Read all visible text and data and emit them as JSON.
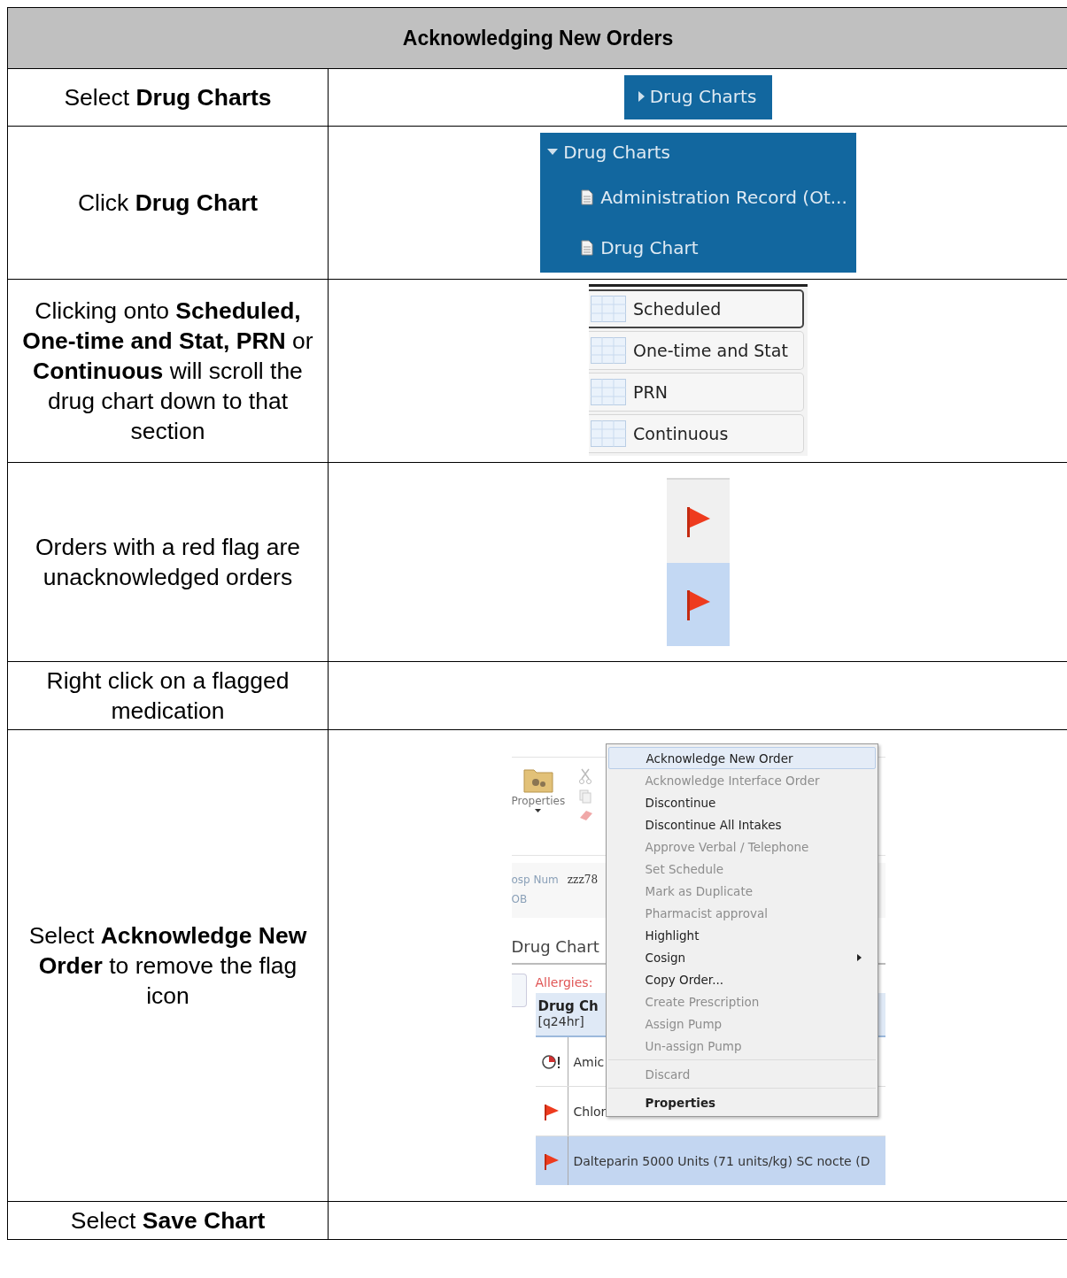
{
  "table": {
    "title": "Acknowledging New Orders",
    "rows": [
      {
        "instruction": "Select **Drug Charts**",
        "visual": {
          "kind": "nav",
          "expanded": false,
          "label": "Drug Charts"
        }
      },
      {
        "instruction": "Click **Drug Chart**",
        "visual": {
          "kind": "nav",
          "expanded": true,
          "label": "Drug Charts",
          "items": [
            "Administration Record (Ot...",
            "Drug Chart"
          ]
        }
      },
      {
        "instruction": "Clicking onto **Scheduled, One-time and Stat, PRN** or **Continuous** will scroll the drug chart down to that section",
        "visual": {
          "kind": "section-tabs",
          "tabs": [
            {
              "label": "Scheduled",
              "selected": true
            },
            {
              "label": "One-time and Stat",
              "selected": false
            },
            {
              "label": "PRN",
              "selected": false
            },
            {
              "label": "Continuous",
              "selected": false
            }
          ]
        }
      },
      {
        "instruction": "Orders with a red flag are unacknowledged orders",
        "visual": {
          "kind": "flags",
          "rows": [
            {
              "selected": false
            },
            {
              "selected": true
            }
          ]
        }
      },
      {
        "instruction": "Right click on a flagged medication"
      },
      {
        "instruction": "Select **Acknowledge New Order** to remove the flag icon",
        "visual": {
          "kind": "context-menu",
          "toolbar_button": "Properties",
          "hosp_label": "osp Num",
          "hosp_value": "zzz78",
          "dob_label": "OB",
          "heading": "Drug Chart",
          "allergies": "Allergies:",
          "section_title": "Drug Ch",
          "section_frequency": "[q24hr]",
          "orders": [
            {
              "name": "Amic",
              "kind": "clock",
              "selected": false
            },
            {
              "name": "Chlor",
              "kind": "flag",
              "selected": false
            },
            {
              "name": "Dalteparin 5000 Units (71 units/kg) SC nocte (D",
              "kind": "flag",
              "selected": true
            }
          ],
          "menu": [
            {
              "items": [
                {
                  "label": "Acknowledge New Order",
                  "disabled": false,
                  "selected": true,
                  "submenu": false,
                  "default": false
                },
                {
                  "label": "Acknowledge Interface Order",
                  "disabled": true,
                  "selected": false,
                  "submenu": false,
                  "default": false
                },
                {
                  "label": "Discontinue",
                  "disabled": false,
                  "selected": false,
                  "submenu": false,
                  "default": false
                },
                {
                  "label": "Discontinue All Intakes",
                  "disabled": false,
                  "selected": false,
                  "submenu": false,
                  "default": false
                },
                {
                  "label": "Approve Verbal / Telephone",
                  "disabled": true,
                  "selected": false,
                  "submenu": false,
                  "default": false
                },
                {
                  "label": "Set Schedule",
                  "disabled": true,
                  "selected": false,
                  "submenu": false,
                  "default": false
                },
                {
                  "label": "Mark as Duplicate",
                  "disabled": true,
                  "selected": false,
                  "submenu": false,
                  "default": false
                },
                {
                  "label": "Pharmacist approval",
                  "disabled": true,
                  "selected": false,
                  "submenu": false,
                  "default": false
                },
                {
                  "label": "Highlight",
                  "disabled": false,
                  "selected": false,
                  "submenu": false,
                  "default": false
                },
                {
                  "label": "Cosign",
                  "disabled": false,
                  "selected": false,
                  "submenu": true,
                  "default": false
                },
                {
                  "label": "Copy Order...",
                  "disabled": false,
                  "selected": false,
                  "submenu": false,
                  "default": false
                },
                {
                  "label": "Create Prescription",
                  "disabled": true,
                  "selected": false,
                  "submenu": false,
                  "default": false
                },
                {
                  "label": "Assign Pump",
                  "disabled": true,
                  "selected": false,
                  "submenu": false,
                  "default": false
                },
                {
                  "label": "Un-assign Pump",
                  "disabled": true,
                  "selected": false,
                  "submenu": false,
                  "default": false
                }
              ]
            },
            {
              "items": [
                {
                  "label": "Discard",
                  "disabled": true,
                  "selected": false,
                  "submenu": false,
                  "default": false
                }
              ]
            },
            {
              "items": [
                {
                  "label": "Properties",
                  "disabled": false,
                  "selected": false,
                  "submenu": false,
                  "default": true
                }
              ]
            }
          ]
        }
      },
      {
        "instruction": "Select **Save Chart**"
      }
    ]
  }
}
